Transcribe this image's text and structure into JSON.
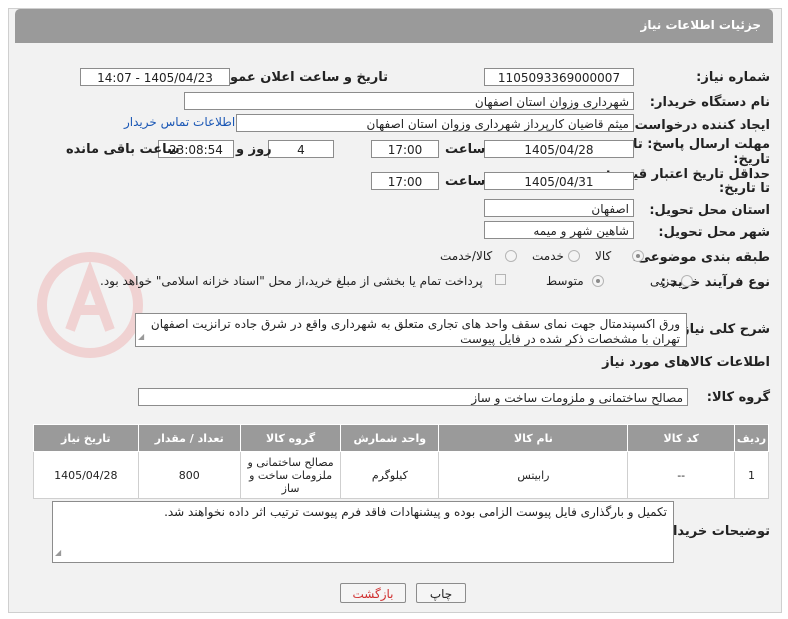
{
  "header": {
    "title": "جزئیات اطلاعات نیاز"
  },
  "form": {
    "need_number_label": "شماره نیاز:",
    "need_number": "1105093369000007",
    "announce_label": "تاریخ و ساعت اعلان عمومی:",
    "announce_value": "1405/04/23 - 14:07",
    "buyer_org_label": "نام دستگاه خریدار:",
    "buyer_org": "شهرداری وزوان استان اصفهان",
    "creator_label": "ایجاد کننده درخواست:",
    "creator": "میثم قاضیان کارپرداز  شهرداری وزوان استان اصفهان",
    "contact_link": "اطلاعات تماس خریدار",
    "deadline_label_1": "مهلت ارسال پاسخ: تا",
    "deadline_label_2": "تاریخ:",
    "deadline_date": "1405/04/28",
    "time_label": "ساعت",
    "deadline_time": "17:00",
    "days_value": "4",
    "days_label": "روز و",
    "remaining_value": "23:08:54",
    "remaining_label": "ساعت باقی مانده",
    "validity_label_1": "حداقل تاریخ اعتبار قیمت:",
    "validity_label_2": "تا تاریخ:",
    "validity_date": "1405/04/31",
    "validity_time": "17:00",
    "province_label": "استان محل تحویل:",
    "province": "اصفهان",
    "city_label": "شهر محل تحویل:",
    "city": "شاهین شهر و میمه",
    "category_label": "طبقه بندی موضوعی:",
    "category_options": [
      "کالا",
      "خدمت",
      "کالا/خدمت"
    ],
    "process_label": "نوع فرآیند خرید :",
    "process_options": [
      "جزیی",
      "متوسط"
    ],
    "payment_note": "پرداخت تمام یا بخشی از مبلغ خرید،از محل \"اسناد خزانه اسلامی\" خواهد بود."
  },
  "description": {
    "label": "شرح کلی نیاز:",
    "text": "ورق اکسپندمتال جهت نمای سقف واحد های تجاری متعلق به شهرداری واقع در شرق جاده ترانزیت اصفهان تهران با مشخصات ذکر شده در فایل پیوست"
  },
  "goods": {
    "section_title": "اطلاعات کالاهای مورد نیاز",
    "group_label": "گروه کالا:",
    "group_value": "مصالح ساختمانی و ملزومات ساخت و ساز",
    "columns": [
      "ردیف",
      "کد کالا",
      "نام کالا",
      "واحد شمارش",
      "گروه کالا",
      "تعداد / مقدار",
      "تاریخ نیاز"
    ],
    "rows": [
      [
        "1",
        "--",
        "رابیتس",
        "کیلوگرم",
        "مصالح ساختمانی و ملزومات ساخت و ساز",
        "800",
        "1405/04/28"
      ]
    ]
  },
  "notes": {
    "label": "توضیحات خریدار:",
    "text": "تکمیل و بارگذاری فایل پیوست الزامی بوده و پیشنهادات فاقد فرم پیوست ترتیب اثر داده نخواهند شد."
  },
  "buttons": {
    "print": "چاپ",
    "back": "بازگشت"
  },
  "colors": {
    "header_bg": "#9a9a9a",
    "link": "#1a57b5",
    "back_text": "#d03030"
  }
}
